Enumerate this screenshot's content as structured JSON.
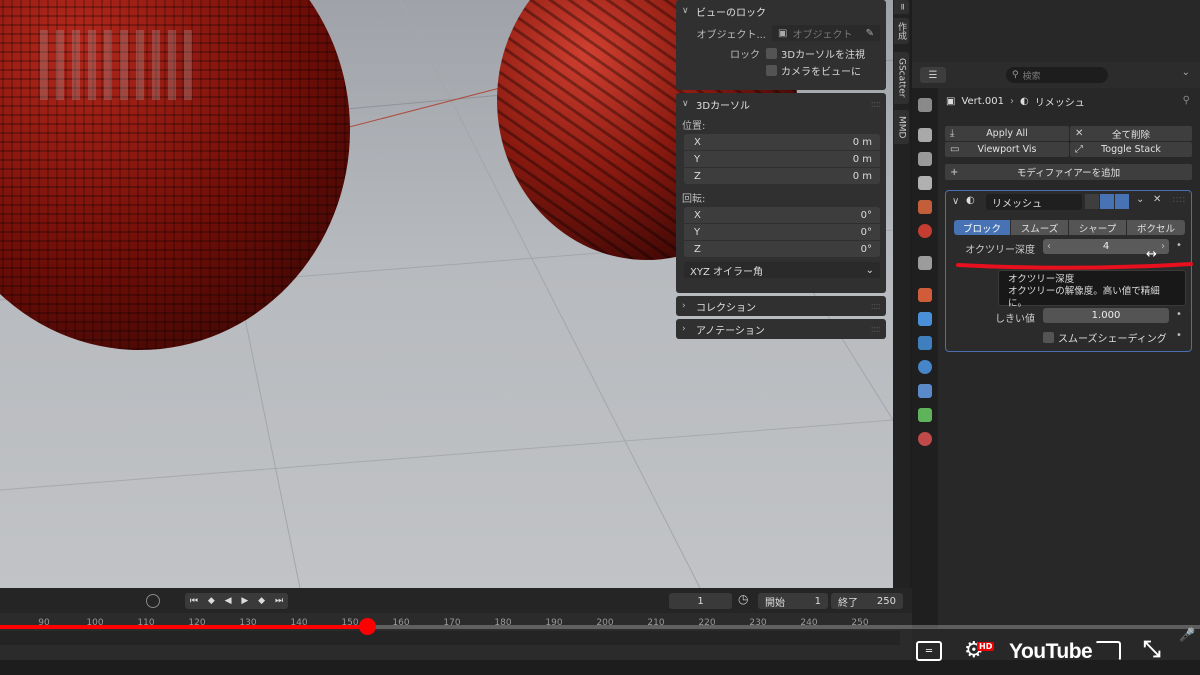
{
  "viewport": {
    "view_lock": {
      "header": "ビューのロック",
      "object_label": "オブジェクト...",
      "object_placeholder": "オブジェクト",
      "lock_label": "ロック",
      "lock_options": [
        "3Dカーソルを注視",
        "カメラをビューに"
      ]
    },
    "cursor3d": {
      "header": "3Dカーソル",
      "location_label": "位置:",
      "location": [
        {
          "axis": "X",
          "value": "0 m"
        },
        {
          "axis": "Y",
          "value": "0 m"
        },
        {
          "axis": "Z",
          "value": "0 m"
        }
      ],
      "rotation_label": "回転:",
      "rotation": [
        {
          "axis": "X",
          "value": "0°"
        },
        {
          "axis": "Y",
          "value": "0°"
        },
        {
          "axis": "Z",
          "value": "0°"
        }
      ],
      "rotation_mode": "XYZ オイラー角"
    },
    "collection_header": "コレクション",
    "annotation_header": "アノテーション"
  },
  "side_tabs": [
    "作成",
    "GScatter",
    "MMD"
  ],
  "properties": {
    "search_placeholder": "検索",
    "breadcrumb_object": "Vert.001",
    "breadcrumb_modifier": "リメッシュ",
    "apply_all": "Apply All",
    "delete_all": "全て削除",
    "viewport_vis": "Viewport Vis",
    "toggle_stack": "Toggle Stack",
    "add_modifier": "モディファイアーを追加",
    "modifier": {
      "name": "リメッシュ",
      "modes": [
        "ブロック",
        "スムーズ",
        "シャープ",
        "ボクセル"
      ],
      "active_mode": "ブロック",
      "octree_label": "オクツリー深度",
      "octree_value": "4",
      "threshold_label": "しきい値",
      "threshold_value": "1.000",
      "smooth_shading_label": "スムーズシェーディング"
    },
    "tooltip_title": "オクツリー深度",
    "tooltip_body": "オクツリーの解像度。高い値で精細に。"
  },
  "timeline": {
    "current_frame": "1",
    "start_label": "開始",
    "start_value": "1",
    "end_label": "終了",
    "end_value": "250",
    "ticks": [
      "90",
      "100",
      "110",
      "120",
      "130",
      "140",
      "150",
      "160",
      "170",
      "180",
      "190",
      "200",
      "210",
      "220",
      "230",
      "240",
      "250"
    ]
  },
  "youtube": {
    "progress": 0.306,
    "logo_text": "YouTube",
    "hd_badge": "HD"
  },
  "colors": {
    "accent": "#4772b3",
    "progress_red": "#ff0000"
  }
}
